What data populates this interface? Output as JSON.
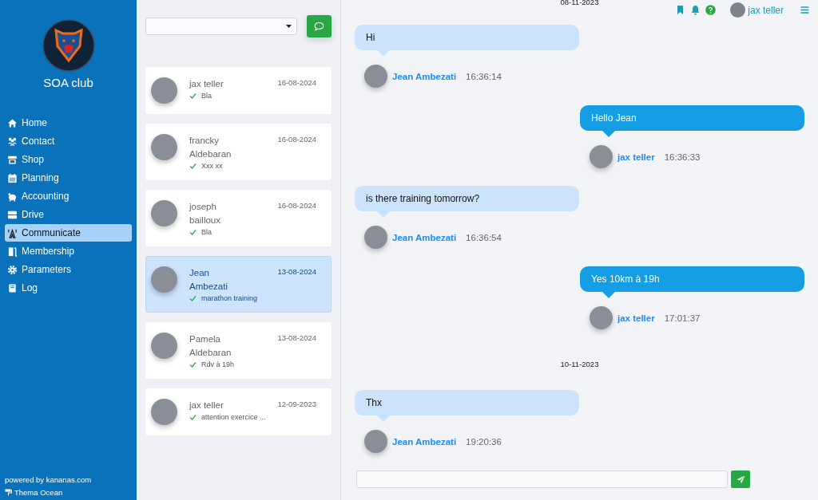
{
  "sidebar": {
    "club_name": "SOA club",
    "menu": [
      {
        "label": "Home",
        "selected": false
      },
      {
        "label": "Contact",
        "selected": false
      },
      {
        "label": "Shop",
        "selected": false
      },
      {
        "label": "Planning",
        "selected": false
      },
      {
        "label": "Accounting",
        "selected": false
      },
      {
        "label": "Drive",
        "selected": false
      },
      {
        "label": "Communicate",
        "selected": true
      },
      {
        "label": "Membership",
        "selected": false
      },
      {
        "label": "Parameters",
        "selected": false
      },
      {
        "label": "Log",
        "selected": false
      }
    ],
    "footer": {
      "powered_by": "powered by kananas.com",
      "theme": "Thema Ocean"
    }
  },
  "conversations": [
    {
      "name": "jax teller",
      "date": "16-08-2024",
      "preview": "Bla",
      "selected": false
    },
    {
      "name": "francky Aldebaran",
      "date": "16-08-2024",
      "preview": "Xxx xx",
      "selected": false
    },
    {
      "name": "joseph bailloux",
      "date": "16-08-2024",
      "preview": "Bla",
      "selected": false
    },
    {
      "name": "Jean Ambezati",
      "date": "13-08-2024",
      "preview": "marathon training",
      "selected": true
    },
    {
      "name": "Pamela Aldebaran",
      "date": "13-08-2024",
      "preview": "Rdv à 19h",
      "selected": false
    },
    {
      "name": "jax teller",
      "date": "12-09-2023",
      "preview": "attention exercice ...",
      "selected": false
    }
  ],
  "header": {
    "user_name": "jax teller"
  },
  "chat": [
    {
      "kind": "date",
      "text": "08-11-2023"
    },
    {
      "kind": "message",
      "outgoing": false,
      "text": "Hi",
      "sender": "Jean Ambezati",
      "time": "16:36:14"
    },
    {
      "kind": "message",
      "outgoing": true,
      "text": "Hello Jean",
      "sender": "jax teller",
      "time": "16:36:33"
    },
    {
      "kind": "message",
      "outgoing": false,
      "text": "is there training tomorrow?",
      "sender": "Jean Ambezati",
      "time": "16:36:54"
    },
    {
      "kind": "message",
      "outgoing": true,
      "text": "Yes 10km à 19h",
      "sender": "jax teller",
      "time": "17:01:37"
    },
    {
      "kind": "date",
      "text": "10-11-2023"
    },
    {
      "kind": "message",
      "outgoing": false,
      "text": "Thx",
      "sender": "Jean Ambezati",
      "time": "19:20:36"
    }
  ]
}
